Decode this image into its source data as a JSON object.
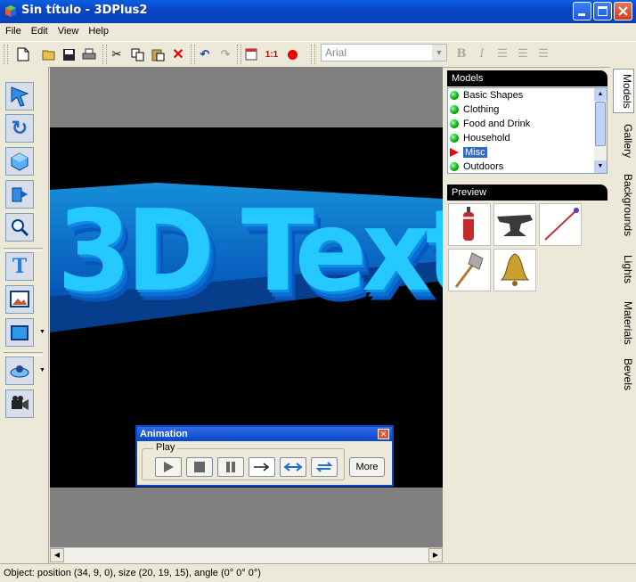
{
  "window": {
    "title": "Sin título - 3DPlus2"
  },
  "menu": [
    "File",
    "Edit",
    "View",
    "Help"
  ],
  "toolbar": {
    "font_name": "Arial"
  },
  "scene": {
    "text": "3D Text",
    "text_color": "#25c8ff"
  },
  "models": {
    "header": "Models",
    "items": [
      {
        "label": "Basic Shapes",
        "state": "normal"
      },
      {
        "label": "Clothing",
        "state": "normal"
      },
      {
        "label": "Food and Drink",
        "state": "normal"
      },
      {
        "label": "Household",
        "state": "normal"
      },
      {
        "label": "Misc",
        "state": "selected"
      },
      {
        "label": "Outdoors",
        "state": "normal"
      }
    ]
  },
  "preview": {
    "header": "Preview",
    "items": [
      "punching-bag-icon",
      "anvil-icon",
      "arrow-icon",
      "battle-axe-icon",
      "bell-icon"
    ]
  },
  "side_tabs": [
    "Models",
    "Gallery",
    "Backgrounds",
    "Lights",
    "Materials",
    "Bevels"
  ],
  "animation": {
    "title": "Animation",
    "group_label": "Play",
    "buttons": [
      "play-icon",
      "stop-icon",
      "pause-icon",
      "play-once-icon",
      "ping-pong-icon",
      "loop-icon"
    ],
    "more_label": "More"
  },
  "status": {
    "text": "Object: position (34, 9, 0), size (20, 19, 15), angle (0° 0° 0°)"
  }
}
